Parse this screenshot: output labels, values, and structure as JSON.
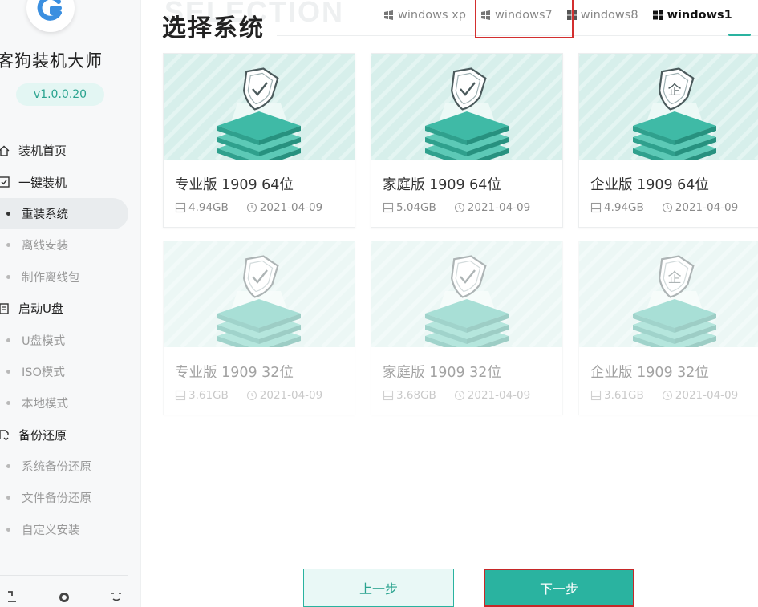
{
  "app": {
    "name": "客狗装机大师",
    "version": "v1.0.0.20"
  },
  "sidebar": {
    "items": [
      {
        "label": "装机首页",
        "type": "group",
        "icon": "home-icon"
      },
      {
        "label": "一键装机",
        "type": "group",
        "icon": "checkbox-icon"
      },
      {
        "label": "重装系统",
        "type": "sub",
        "active": true
      },
      {
        "label": "离线安装",
        "type": "sub"
      },
      {
        "label": "制作离线包",
        "type": "sub"
      },
      {
        "label": "启动U盘",
        "type": "group",
        "icon": "usb-icon"
      },
      {
        "label": "U盘模式",
        "type": "sub"
      },
      {
        "label": "ISO模式",
        "type": "sub"
      },
      {
        "label": "本地模式",
        "type": "sub"
      },
      {
        "label": "备份还原",
        "type": "group",
        "icon": "backup-icon"
      },
      {
        "label": "系统备份还原",
        "type": "sub"
      },
      {
        "label": "文件备份还原",
        "type": "sub"
      },
      {
        "label": "自定义安装",
        "type": "sub"
      }
    ]
  },
  "header": {
    "title": "选择系统",
    "ghost_title": "SELECTION",
    "tabs": [
      {
        "label": "windows xp",
        "icon": "windows-xp-icon"
      },
      {
        "label": "windows7",
        "icon": "windows-7-icon"
      },
      {
        "label": "windows8",
        "icon": "windows-8-icon"
      },
      {
        "label": "windows1",
        "icon": "windows-10-icon",
        "active": true
      }
    ]
  },
  "cards": [
    {
      "name": "专业版 1909 64位",
      "size": "4.94GB",
      "date": "2021-04-09",
      "badge": "check"
    },
    {
      "name": "家庭版 1909 64位",
      "size": "5.04GB",
      "date": "2021-04-09",
      "badge": "check"
    },
    {
      "name": "企业版 1909 64位",
      "size": "4.94GB",
      "date": "2021-04-09",
      "badge": "企"
    },
    {
      "name": "专业版 1909 32位",
      "size": "3.61GB",
      "date": "2021-04-09",
      "badge": "check"
    },
    {
      "name": "家庭版 1909 32位",
      "size": "3.68GB",
      "date": "2021-04-09",
      "badge": "check"
    },
    {
      "name": "企业版 1909 32位",
      "size": "3.61GB",
      "date": "2021-04-09",
      "badge": "企"
    }
  ],
  "buttons": {
    "prev": "上一步",
    "next": "下一步"
  },
  "colors": {
    "accent": "#2ab3a0",
    "highlight": "#d32f2f",
    "thumb_bg": "#d7efeb"
  }
}
